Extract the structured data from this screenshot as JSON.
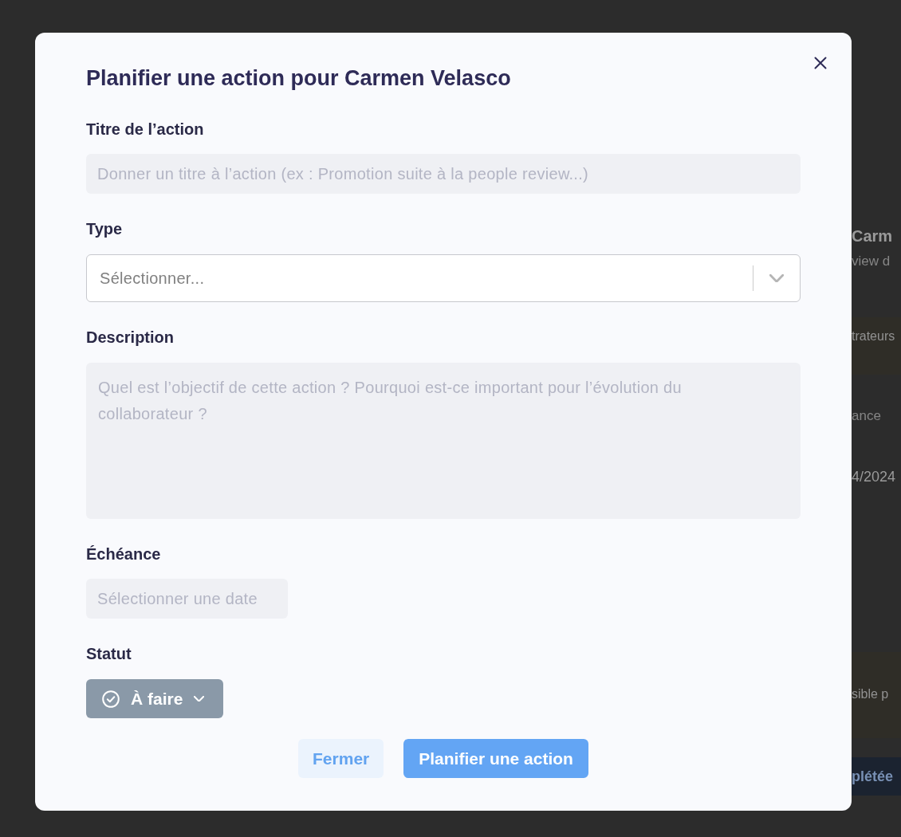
{
  "background_page": {
    "items": [
      {
        "kind": "name",
        "text": "Carm"
      },
      {
        "kind": "subtitle",
        "text": "view d"
      },
      {
        "kind": "warning",
        "text": "trateurs"
      },
      {
        "kind": "label",
        "text": "ance"
      },
      {
        "kind": "value",
        "text": "4/2024"
      },
      {
        "kind": "notice",
        "text": "sible p"
      },
      {
        "kind": "button",
        "text": "plétée"
      }
    ]
  },
  "modal": {
    "title": "Planifier une action pour Carmen Velasco",
    "fields": [
      {
        "kind": "text",
        "label": "Titre de l’action",
        "placeholder": "Donner un titre à l’action (ex : Promotion suite à la people review...)"
      },
      {
        "kind": "select",
        "label": "Type",
        "placeholder": "Sélectionner..."
      },
      {
        "kind": "textarea",
        "label": "Description",
        "placeholder": "Quel est l’objectif de cette action ? Pourquoi est-ce important pour l’évolution du collaborateur ?"
      },
      {
        "kind": "date",
        "label": "Échéance",
        "placeholder": "Sélectionner une date"
      },
      {
        "kind": "status",
        "label": "Statut",
        "value": "À faire"
      }
    ],
    "buttons": [
      {
        "kind": "secondary",
        "label": "Fermer"
      },
      {
        "kind": "primary",
        "label": "Planifier une action"
      }
    ]
  }
}
